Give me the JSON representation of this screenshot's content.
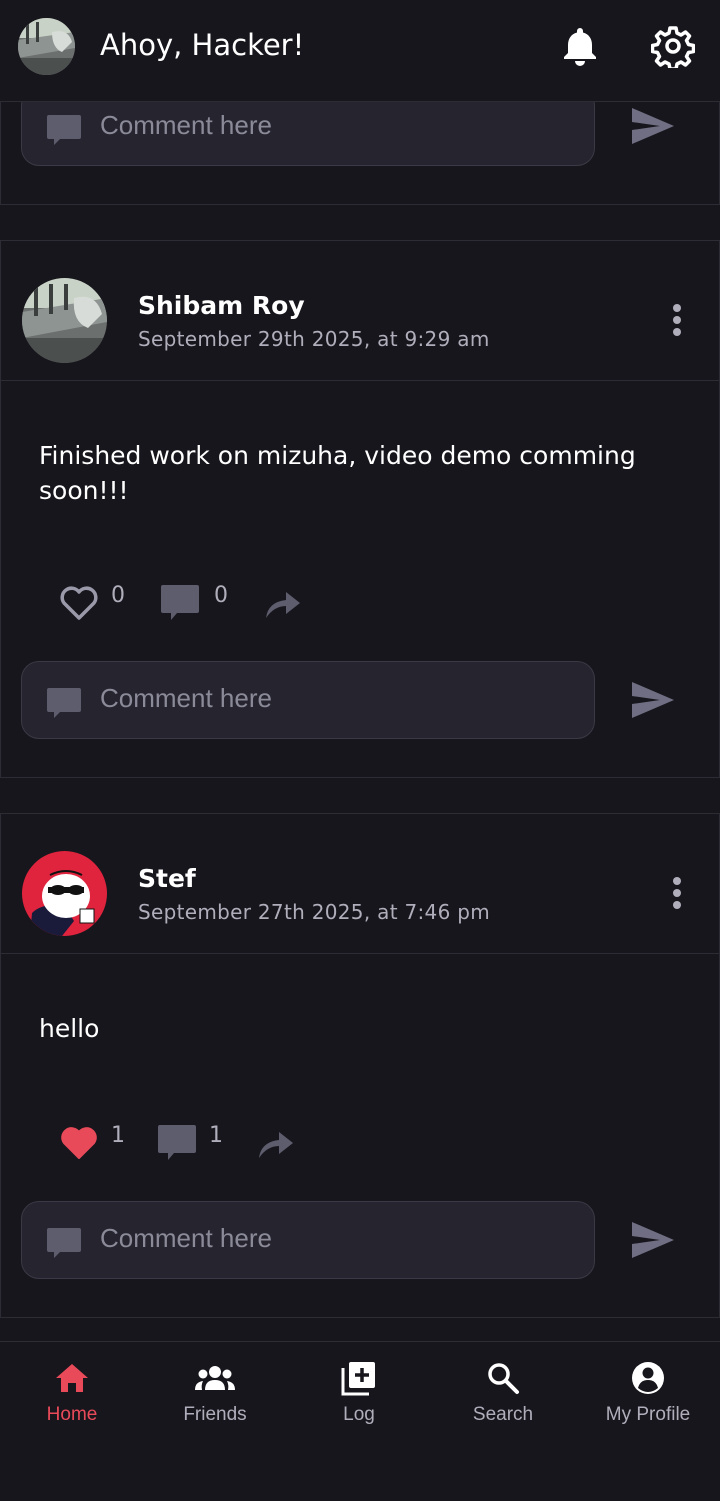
{
  "header": {
    "greeting": "Ahoy, Hacker!",
    "icons": [
      "bell-icon",
      "settings-gear-icon"
    ]
  },
  "colors": {
    "background": "#17161c",
    "accent": "#e94a5a",
    "muted_text": "#b0aebb",
    "card_border": "#2d2c34"
  },
  "top_comment": {
    "placeholder": "Comment here"
  },
  "posts": [
    {
      "author": "Shibam Roy",
      "date": "September 29th 2025, at 9:29 am",
      "text": "Finished work on mizuha, video demo comming soon!!!",
      "likes": "0",
      "comments": "0",
      "liked": false,
      "comment_placeholder": "Comment here"
    },
    {
      "author": "Stef",
      "date": "September 27th 2025, at 7:46 pm",
      "text": "hello",
      "likes": "1",
      "comments": "1",
      "liked": true,
      "comment_placeholder": "Comment here"
    }
  ],
  "nav": {
    "items": [
      {
        "label": "Home",
        "icon": "home-icon",
        "active": true
      },
      {
        "label": "Friends",
        "icon": "friends-icon",
        "active": false
      },
      {
        "label": "Log",
        "icon": "add-post-icon",
        "active": false
      },
      {
        "label": "Search",
        "icon": "search-icon",
        "active": false
      },
      {
        "label": "My Profile",
        "icon": "profile-icon",
        "active": false
      }
    ]
  }
}
